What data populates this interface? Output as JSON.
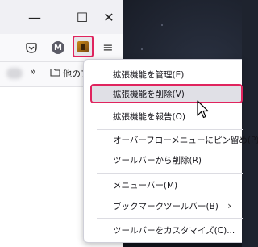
{
  "window": {
    "minimize_label": "—",
    "maximize_label": "☐",
    "close_label": "✕",
    "menu_label": "≡"
  },
  "toolbar": {
    "account_initial": "M"
  },
  "bookmarks": {
    "chevron": "»",
    "folder_label": "他のブ"
  },
  "context_menu": {
    "items": [
      {
        "label": "拡張機能を管理(E)",
        "hovered": false
      },
      {
        "label": "拡張機能を削除(V)",
        "hovered": true
      },
      {
        "label": "拡張機能を報告(O)",
        "hovered": false
      },
      {
        "label": "オーバーフローメニューにピン留め(P)",
        "hovered": false
      },
      {
        "label": "ツールバーから削除(R)",
        "hovered": false
      },
      {
        "label": "メニューバー(M)",
        "hovered": false
      },
      {
        "label": "ブックマークツールバー(B)",
        "hovered": false,
        "has_submenu": true,
        "submenu_arrow": "›"
      },
      {
        "label": "ツールバーをカスタマイズ(C)...",
        "hovered": false
      }
    ]
  },
  "colors": {
    "highlight": "#e0245e",
    "hover_bg": "#e0e0e6",
    "chrome_bg": "#f0f0f4"
  }
}
